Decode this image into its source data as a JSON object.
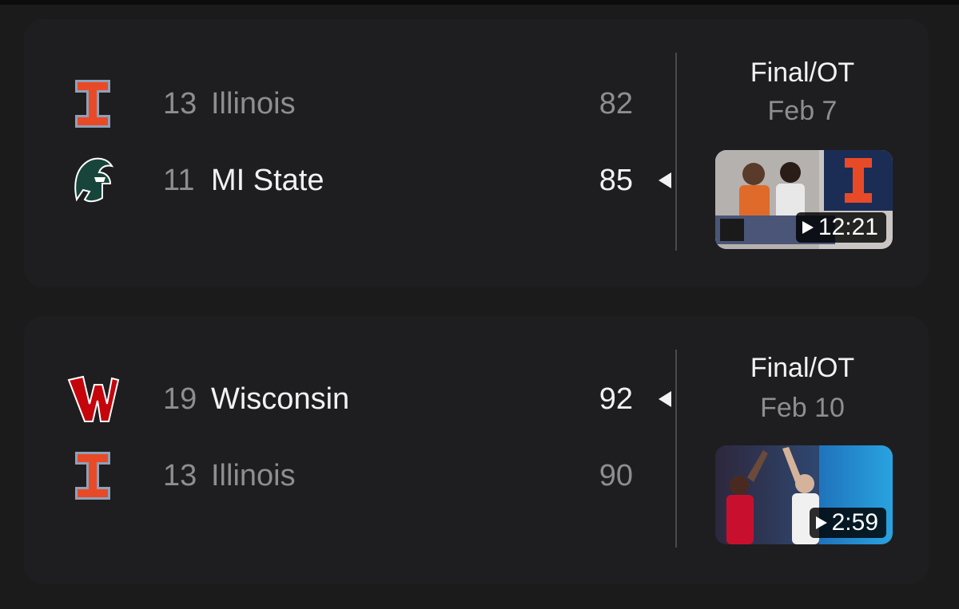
{
  "games": [
    {
      "teams": [
        {
          "rank": "13",
          "name": "Illinois",
          "score": "82",
          "winner": false,
          "logo": "illinois-logo"
        },
        {
          "rank": "11",
          "name": "MI State",
          "score": "85",
          "winner": true,
          "logo": "michigan-state-spartan-logo"
        }
      ],
      "status": "Final/OT",
      "date": "Feb 7",
      "video": {
        "duration": "12:21",
        "thumbnail": "fox-highlights-thumbnail"
      }
    },
    {
      "teams": [
        {
          "rank": "19",
          "name": "Wisconsin",
          "score": "92",
          "winner": true,
          "logo": "wisconsin-logo"
        },
        {
          "rank": "13",
          "name": "Illinois",
          "score": "90",
          "winner": false,
          "logo": "illinois-logo"
        }
      ],
      "status": "Final/OT",
      "date": "Feb 10",
      "video": {
        "duration": "2:59",
        "thumbnail": "game-highlights-thumbnail"
      }
    }
  ],
  "colors": {
    "background": "#1b1b1c",
    "card": "#1e1e20",
    "text_primary": "#f2f2f2",
    "text_secondary": "#8e8e90",
    "illinois_orange": "#e84a27",
    "illinois_blue": "#13294b",
    "msu_green": "#18453b",
    "wisconsin_red": "#c5050c"
  }
}
